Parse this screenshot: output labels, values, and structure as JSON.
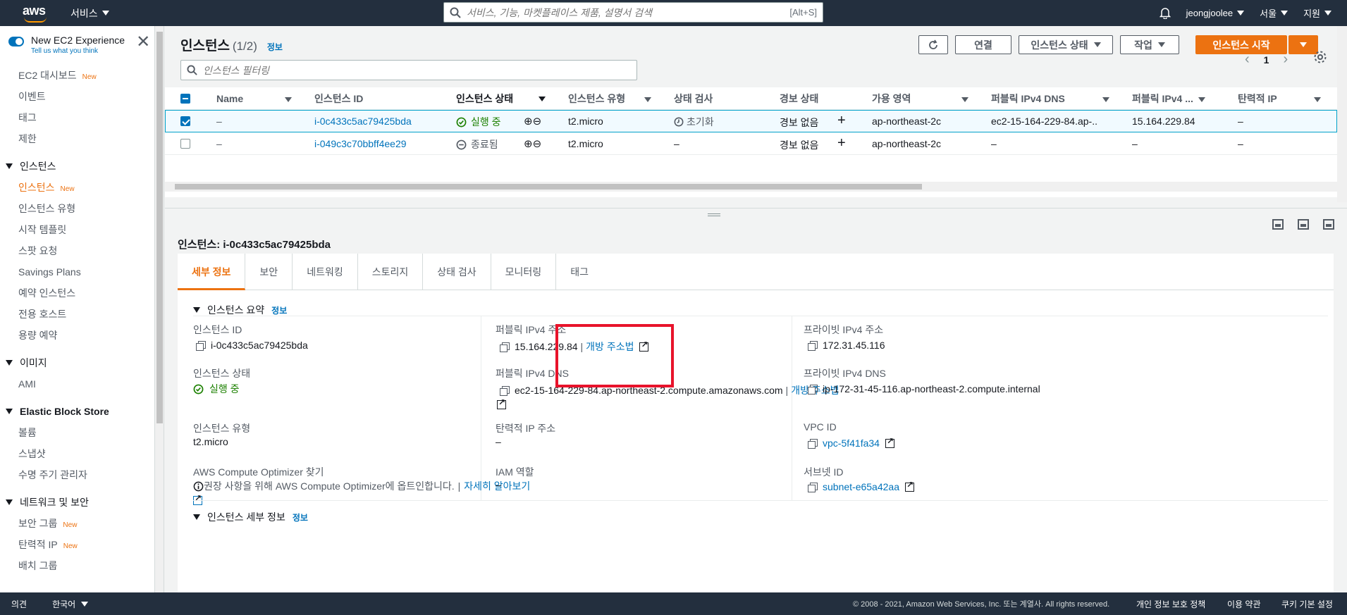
{
  "topnav": {
    "logo": "aws",
    "services": "서비스",
    "search_placeholder": "서비스, 기능, 마켓플레이스 제품, 설명서 검색",
    "search_shortcut": "[Alt+S]",
    "user": "jeongjoolee",
    "region": "서울",
    "support": "지원"
  },
  "sidebar": {
    "experience_title": "New EC2 Experience",
    "experience_sub": "Tell us what you think",
    "new_badge": "New",
    "top_links": [
      "EC2 대시보드",
      "이벤트",
      "태그",
      "제한"
    ],
    "sections": [
      {
        "title": "인스턴스",
        "items": [
          "인스턴스",
          "인스턴스 유형",
          "시작 템플릿",
          "스팟 요청",
          "Savings Plans",
          "예약 인스턴스",
          "전용 호스트",
          "용량 예약"
        ]
      },
      {
        "title": "이미지",
        "items": [
          "AMI"
        ]
      },
      {
        "title": "Elastic Block Store",
        "items": [
          "볼륨",
          "스냅샷",
          "수명 주기 관리자"
        ]
      },
      {
        "title": "네트워크 및 보안",
        "items": [
          "보안 그룹",
          "탄력적 IP",
          "배치 그룹"
        ]
      }
    ]
  },
  "header": {
    "title": "인스턴스",
    "count": "(1/2)",
    "info": "정보",
    "connect": "연결",
    "state": "인스턴스 상태",
    "actions": "작업",
    "launch": "인스턴스 시작",
    "filter_placeholder": "인스턴스 필터링",
    "page": "1"
  },
  "table": {
    "columns": [
      "Name",
      "인스턴스 ID",
      "인스턴스 상태",
      "인스턴스 유형",
      "상태 검사",
      "경보 상태",
      "가용 영역",
      "퍼블릭 IPv4 DNS",
      "퍼블릭 IPv4 ...",
      "탄력적 IP"
    ],
    "rows": [
      {
        "name": "–",
        "id": "i-0c433c5ac79425bda",
        "state": "실행 중",
        "type": "t2.micro",
        "check": "초기화",
        "alarm": "경보 없음",
        "az": "ap-northeast-2c",
        "dns": "ec2-15-164-229-84.ap-...",
        "ip": "15.164.229.84",
        "eip": "–"
      },
      {
        "name": "–",
        "id": "i-049c3c70bbff4ee29",
        "state": "종료됨",
        "type": "t2.micro",
        "check": "–",
        "alarm": "경보 없음",
        "az": "ap-northeast-2c",
        "dns": "–",
        "ip": "–",
        "eip": "–"
      }
    ]
  },
  "detail": {
    "title": "인스턴스: i-0c433c5ac79425bda",
    "tabs": [
      "세부 정보",
      "보안",
      "네트워킹",
      "스토리지",
      "상태 검사",
      "모니터링",
      "태그"
    ],
    "summary_title": "인스턴스 요약",
    "summary_info": "정보",
    "instance_id_label": "인스턴스 ID",
    "instance_id": "i-0c433c5ac79425bda",
    "public_ip_label": "퍼블릭 IPv4 주소",
    "public_ip": "15.164.229.84",
    "open_address": "개방 주소법",
    "private_ip_label": "프라이빗 IPv4 주소",
    "private_ip": "172.31.45.116",
    "state_label": "인스턴스 상태",
    "state": "실행 중",
    "public_dns_label": "퍼블릭 IPv4 DNS",
    "public_dns": "ec2-15-164-229-84.ap-northeast-2.compute.amazonaws.com",
    "private_dns_label": "프라이빗 IPv4 DNS",
    "private_dns": "ip-172-31-45-116.ap-northeast-2.compute.internal",
    "type_label": "인스턴스 유형",
    "type": "t2.micro",
    "eip_label": "탄력적 IP 주소",
    "eip": "–",
    "vpc_label": "VPC ID",
    "vpc": "vpc-5f41fa34",
    "optimizer_label": "AWS Compute Optimizer 찾기",
    "optimizer_text": "권장 사항을 위해 AWS Compute Optimizer에 옵트인합니다.",
    "optimizer_link": "자세히 알아보기",
    "iam_label": "IAM 역할",
    "iam": "–",
    "subnet_label": "서브넷 ID",
    "subnet": "subnet-e65a42aa",
    "details_title": "인스턴스 세부 정보",
    "details_info": "정보"
  },
  "footer": {
    "feedback": "의견",
    "language": "한국어",
    "copyright": "© 2008 - 2021, Amazon Web Services, Inc. 또는 계열사. All rights reserved.",
    "privacy": "개인 정보 보호 정책",
    "terms": "이용 약관",
    "cookies": "쿠키 기본 설정"
  },
  "colors": {
    "nav_bg": "#232f3e",
    "accent": "#ec7211",
    "link": "#0073bb",
    "success": "#1d8102",
    "highlight": "#e8132b"
  }
}
